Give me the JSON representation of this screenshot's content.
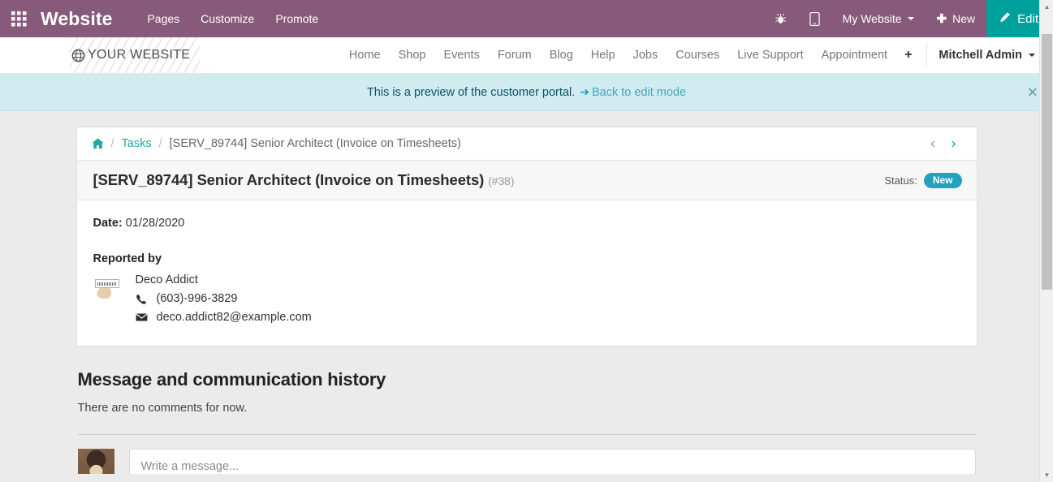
{
  "backend_bar": {
    "apps_icon": "apps-grid-icon",
    "brand": "Website",
    "menus": [
      {
        "label": "Pages"
      },
      {
        "label": "Customize"
      },
      {
        "label": "Promote"
      }
    ],
    "systray": [
      {
        "icon": "bug-icon",
        "glyph": "🐞",
        "label": ""
      },
      {
        "icon": "mobile-preview-icon",
        "glyph": "📱",
        "label": ""
      }
    ],
    "website_selector": "My Website",
    "new_button": "New",
    "new_icon": "plus-icon",
    "edit_button": "Edit",
    "edit_icon": "pencil-icon",
    "colors": {
      "bar": "#875A7B",
      "edit": "#00A09D"
    }
  },
  "site_nav": {
    "logo_text": "YOUR WEBSITE",
    "logo_icon": "globe-icon",
    "links": [
      {
        "label": "Home"
      },
      {
        "label": "Shop"
      },
      {
        "label": "Events"
      },
      {
        "label": "Forum"
      },
      {
        "label": "Blog"
      },
      {
        "label": "Help"
      },
      {
        "label": "Jobs"
      },
      {
        "label": "Courses"
      },
      {
        "label": "Live Support"
      },
      {
        "label": "Appointment"
      }
    ],
    "add_link": "+",
    "user": "Mitchell Admin"
  },
  "preview_banner": {
    "text": "This is a preview of the customer portal.",
    "arrow_icon": "arrow-right-icon",
    "arrow_glyph": "➔",
    "link": "Back to edit mode",
    "close_icon": "close-icon",
    "close_glyph": "✕",
    "bg": "#d1ecf1"
  },
  "breadcrumb": {
    "home_icon": "home-icon",
    "items": [
      {
        "label": "Tasks",
        "link": true
      },
      {
        "label": "[SERV_89744] Senior Architect (Invoice on Timesheets)",
        "link": false
      }
    ],
    "separator": "/",
    "prev_icon": "chevron-left-icon",
    "prev_glyph": "‹",
    "next_icon": "chevron-right-icon",
    "next_glyph": "›"
  },
  "task": {
    "title": "[SERV_89744] Senior Architect (Invoice on Timesheets)",
    "reference": "(#38)",
    "status_label": "Status:",
    "status_value": "New",
    "status_color": "#23a1bd",
    "date_label": "Date:",
    "date_value": "01/28/2020",
    "reported_by_label": "Reported by",
    "contact": {
      "avatar": "contact-avatar",
      "name": "Deco Addict",
      "phone_icon": "phone-icon",
      "phone_glyph": "📞",
      "phone": "(603)-996-3829",
      "email_icon": "envelope-icon",
      "email_glyph": "✉",
      "email": "deco.addict82@example.com"
    }
  },
  "history": {
    "heading": "Message and communication history",
    "empty_text": "There are no comments for now.",
    "compose_avatar": "user-avatar",
    "compose_placeholder": "Write a message...",
    "compose_value": ""
  }
}
